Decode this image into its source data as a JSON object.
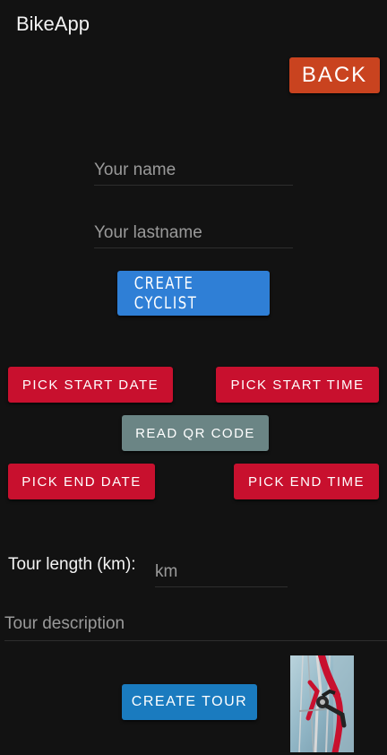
{
  "app": {
    "title": "BikeApp"
  },
  "header": {
    "back_label": "BACK"
  },
  "cyclist_form": {
    "name_placeholder": "Your name",
    "lastname_placeholder": "Your lastname",
    "create_cyclist_label": "CREATE CYCLIST"
  },
  "tour_schedule": {
    "pick_start_date_label": "PICK START DATE",
    "pick_start_time_label": "PICK START TIME",
    "read_qr_code_label": "READ QR CODE",
    "pick_end_date_label": "PICK END DATE",
    "pick_end_time_label": "PICK END TIME"
  },
  "tour_form": {
    "length_label": "Tour length (km):",
    "length_placeholder": "km",
    "description_placeholder": "Tour description",
    "create_tour_label": "CREATE TOUR"
  },
  "colors": {
    "background": "#121212",
    "back_button": "#c9431f",
    "create_cyclist_button": "#2f7fd6",
    "pick_buttons": "#c8102e",
    "qr_button": "#6b8585",
    "create_tour_button": "#1a7bbf"
  },
  "image": {
    "icon": "bicycle-photo"
  }
}
